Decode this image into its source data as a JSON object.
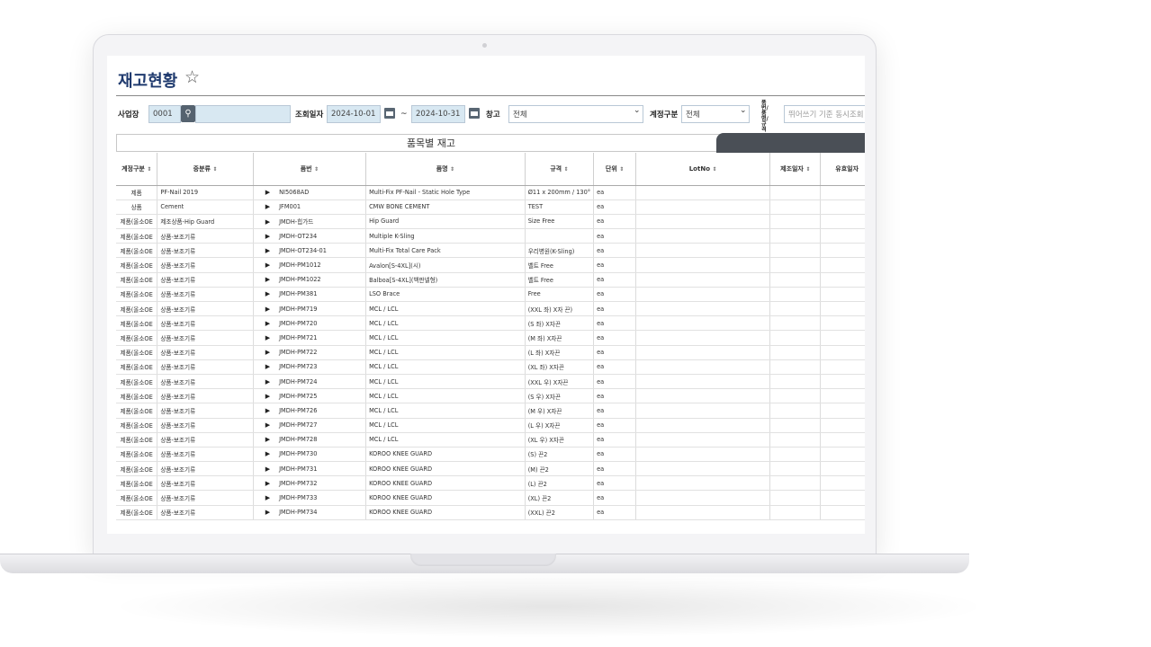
{
  "page": {
    "title": "재고현황",
    "favorite_icon": "star-outline-icon"
  },
  "filters": {
    "site_label": "사업장",
    "site_code": "0001",
    "search_icon": "search-icon",
    "date_label": "조회일자",
    "date_from": "2024-10-01",
    "date_sep": "~",
    "date_to": "2024-10-31",
    "warehouse_label": "창고",
    "warehouse_value": "전체",
    "account_label": "계정구분",
    "account_value": "전체",
    "item_label": "품번/품명/규격",
    "item_placeholder": "뛰어쓰기 기준 동시조회"
  },
  "section": {
    "title": "품목별 재고"
  },
  "table": {
    "columns": [
      "계정구분",
      "중분류",
      "품번",
      "품명",
      "규격",
      "단위",
      "LotNo",
      "제조일자",
      "유효일자"
    ],
    "sort_icon": "⇕",
    "rows": [
      [
        "제품",
        "PF-Nail 2019",
        "NI5068AD",
        "Multi-Fix PF-Nail - Static Hole Type",
        "Ø11 x 200mm / 130°",
        "ea"
      ],
      [
        "상품",
        "Cement",
        "JFM001",
        "CMW BONE CEMENT",
        "TEST",
        "ea"
      ],
      [
        "제품(올소OE",
        "제조상품-Hip Guard",
        "JMDH-힙가드",
        "Hip Guard",
        "Size Free",
        "ea"
      ],
      [
        "제품(올소OE",
        "상품-보조기류",
        "JMDH-OT234",
        "Multiple K-Sling",
        "",
        "ea"
      ],
      [
        "제품(올소OE",
        "상품-보조기류",
        "JMDH-OT234-01",
        "Multi-Fix Total Care Pack",
        "우리병원(K-Sling)",
        "ea"
      ],
      [
        "제품(올소OE",
        "상품-보조기류",
        "JMDH-PM1012",
        "Avalon[S-4XL](시)",
        "벨트 Free",
        "ea"
      ],
      [
        "제품(올소OE",
        "상품-보조기류",
        "JMDH-PM1022",
        "Balboa[S-4XL](백판넬형)",
        "벨트 Free",
        "ea"
      ],
      [
        "제품(올소OE",
        "상품-보조기류",
        "JMDH-PM381",
        "LSO Brace",
        "Free",
        "ea"
      ],
      [
        "제품(올소OE",
        "상품-보조기류",
        "JMDH-PM719",
        "MCL / LCL",
        "(XXL 좌) X자 끈)",
        "ea"
      ],
      [
        "제품(올소OE",
        "상품-보조기류",
        "JMDH-PM720",
        "MCL / LCL",
        "(S 좌) X자끈",
        "ea"
      ],
      [
        "제품(올소OE",
        "상품-보조기류",
        "JMDH-PM721",
        "MCL / LCL",
        "(M 좌) X자끈",
        "ea"
      ],
      [
        "제품(올소OE",
        "상품-보조기류",
        "JMDH-PM722",
        "MCL / LCL",
        "(L 좌) X자끈",
        "ea"
      ],
      [
        "제품(올소OE",
        "상품-보조기류",
        "JMDH-PM723",
        "MCL / LCL",
        "(XL 좌) X자끈",
        "ea"
      ],
      [
        "제품(올소OE",
        "상품-보조기류",
        "JMDH-PM724",
        "MCL / LCL",
        "(XXL 우) X자끈",
        "ea"
      ],
      [
        "제품(올소OE",
        "상품-보조기류",
        "JMDH-PM725",
        "MCL / LCL",
        "(S 우) X자끈",
        "ea"
      ],
      [
        "제품(올소OE",
        "상품-보조기류",
        "JMDH-PM726",
        "MCL / LCL",
        "(M 우) X자끈",
        "ea"
      ],
      [
        "제품(올소OE",
        "상품-보조기류",
        "JMDH-PM727",
        "MCL / LCL",
        "(L 우) X자끈",
        "ea"
      ],
      [
        "제품(올소OE",
        "상품-보조기류",
        "JMDH-PM728",
        "MCL / LCL",
        "(XL 우) X자끈",
        "ea"
      ],
      [
        "제품(올소OE",
        "상품-보조기류",
        "JMDH-PM730",
        "KOROO KNEE GUARD",
        "(S) 끈2",
        "ea"
      ],
      [
        "제품(올소OE",
        "상품-보조기류",
        "JMDH-PM731",
        "KOROO KNEE GUARD",
        "(M) 끈2",
        "ea"
      ],
      [
        "제품(올소OE",
        "상품-보조기류",
        "JMDH-PM732",
        "KOROO KNEE GUARD",
        "(L) 끈2",
        "ea"
      ],
      [
        "제품(올소OE",
        "상품-보조기류",
        "JMDH-PM733",
        "KOROO KNEE GUARD",
        "(XL) 끈2",
        "ea"
      ],
      [
        "제품(올소OE",
        "상품-보조기류",
        "JMDH-PM734",
        "KOROO KNEE GUARD",
        "(XXL) 끈2",
        "ea"
      ]
    ]
  },
  "colors": {
    "title": "#1f3a6e",
    "field_bg": "#d8e8f2",
    "tab_dark": "#4a4f56"
  }
}
